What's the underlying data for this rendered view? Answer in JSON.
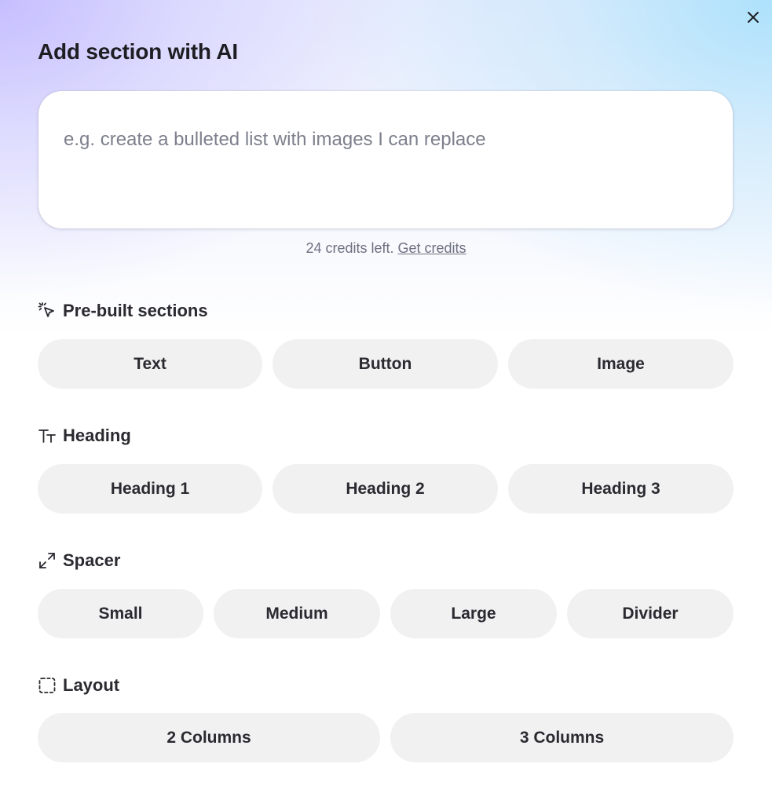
{
  "dialog": {
    "title": "Add section with AI",
    "close_label": "×"
  },
  "prompt": {
    "placeholder": "e.g. create a bulleted list with images I can replace",
    "value": ""
  },
  "credits": {
    "text": "24 credits left.",
    "link": "Get credits"
  },
  "sections": {
    "prebuilt": {
      "label": "Pre-built sections",
      "icon": "sparkle-cursor-icon",
      "buttons": [
        "Text",
        "Button",
        "Image"
      ]
    },
    "heading": {
      "label": "Heading",
      "icon": "text-size-icon",
      "buttons": [
        "Heading 1",
        "Heading 2",
        "Heading 3"
      ]
    },
    "spacer": {
      "label": "Spacer",
      "icon": "expand-arrows-icon",
      "buttons": [
        "Small",
        "Medium",
        "Large",
        "Divider"
      ]
    },
    "layout": {
      "label": "Layout",
      "icon": "dashed-square-icon",
      "buttons": [
        "2 Columns",
        "3 Columns"
      ]
    }
  },
  "colors": {
    "button_bg": "#f1f1f2",
    "text": "#2a2a30",
    "muted": "#6e7180",
    "gradient_left": "#c4bcff",
    "gradient_right": "#aae1fc"
  }
}
